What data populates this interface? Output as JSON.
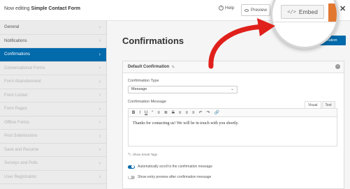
{
  "topbar": {
    "prefix": "Now editing",
    "form_name": "Simple Contact Form",
    "help_label": "Help",
    "preview_label": "Preview",
    "embed_label": "Embed",
    "colors": {
      "orange": "#e27730"
    }
  },
  "sidebar": {
    "items": [
      {
        "label": "General",
        "state": "normal"
      },
      {
        "label": "Notifications",
        "state": "normal"
      },
      {
        "label": "Confirmations",
        "state": "active"
      },
      {
        "label": "Conversational Forms",
        "state": "dim"
      },
      {
        "label": "Form Abandonment",
        "state": "dim"
      },
      {
        "label": "Form Locker",
        "state": "dim"
      },
      {
        "label": "Form Pages",
        "state": "dim"
      },
      {
        "label": "Offline Forms",
        "state": "dim"
      },
      {
        "label": "Post Submissions",
        "state": "dim"
      },
      {
        "label": "Save and Resume",
        "state": "dim"
      },
      {
        "label": "Surveys and Polls",
        "state": "dim"
      },
      {
        "label": "User Registration",
        "state": "dim"
      }
    ],
    "accent": "#036aab"
  },
  "main": {
    "title": "Confirmations",
    "add_button": "Add New Confirmation",
    "panel_title": "Default Confirmation",
    "type_label": "Confirmation Type",
    "type_value": "Message",
    "message_label": "Confirmation Message",
    "tab_visual": "Visual",
    "tab_text": "Text",
    "toolbar": [
      "B",
      "I",
      "U",
      "“",
      "≡",
      "≣",
      "S",
      "≡",
      "≡",
      "≡",
      "↶",
      "↷",
      "🔗"
    ],
    "message_text": "Thanks for contacting us! We will be in touch with you shortly.",
    "smart_tags": "Show Smart Tags",
    "option1": "Automatically scroll to the confirmation message",
    "option1_on": true,
    "option2": "Show entry preview after confirmation message",
    "option2_on": false
  }
}
